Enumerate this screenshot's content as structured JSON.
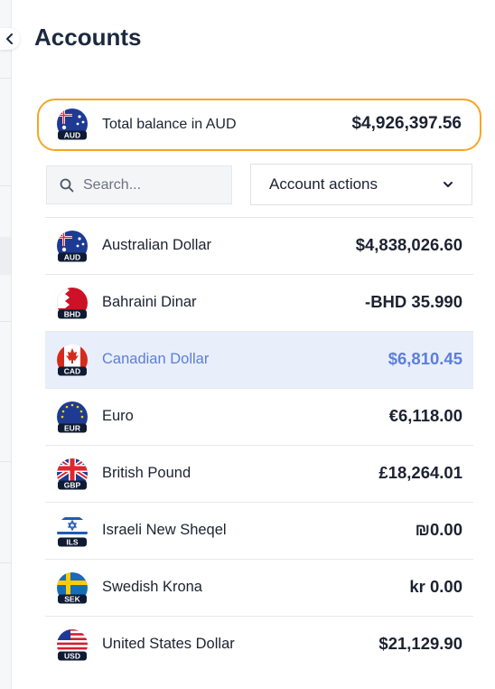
{
  "page": {
    "title": "Accounts"
  },
  "total": {
    "label": "Total balance in AUD",
    "amount": "$4,926,397.56",
    "currency_code": "AUD"
  },
  "search": {
    "placeholder": "Search..."
  },
  "actions": {
    "label": "Account actions"
  },
  "accounts": [
    {
      "code": "AUD",
      "name": "Australian Dollar",
      "amount": "$4,838,026.60"
    },
    {
      "code": "BHD",
      "name": "Bahraini Dinar",
      "amount": "-BHD 35.990"
    },
    {
      "code": "CAD",
      "name": "Canadian Dollar",
      "amount": "$6,810.45",
      "selected": true
    },
    {
      "code": "EUR",
      "name": "Euro",
      "amount": "€6,118.00"
    },
    {
      "code": "GBP",
      "name": "British Pound",
      "amount": "£18,264.01"
    },
    {
      "code": "ILS",
      "name": "Israeli New Sheqel",
      "amount": "₪0.00"
    },
    {
      "code": "SEK",
      "name": "Swedish Krona",
      "amount": "kr 0.00"
    },
    {
      "code": "USD",
      "name": "United States Dollar",
      "amount": "$21,129.90"
    }
  ],
  "colors": {
    "accent": "#f5a623",
    "selected_bg": "#e9eefb",
    "selected_text": "#5b7fd9",
    "title": "#1b2940"
  }
}
